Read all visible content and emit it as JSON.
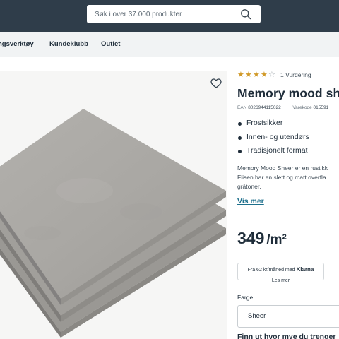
{
  "search": {
    "placeholder": "Søk i over 37.000 produkter",
    "value": ""
  },
  "nav": {
    "items": [
      {
        "label": "ngsverktøy"
      },
      {
        "label": "Kundeklubb"
      },
      {
        "label": "Outlet"
      }
    ]
  },
  "product": {
    "rating": {
      "stars": 4,
      "max": 5,
      "reviews_label": "1 Vurdering"
    },
    "title": "Memory mood she",
    "ean_label": "EAN",
    "ean": "8026944115022",
    "sku_label": "Varekode",
    "sku": "015591",
    "bullets": [
      "Frostsikker",
      "Innen- og utendørs",
      "Tradisjonelt format"
    ],
    "description_lines": [
      "Memory Mood Sheer er en rustikk",
      "Flisen har en slett og matt overfla",
      "gråtoner."
    ],
    "more_link": "Vis mer",
    "price": {
      "value": "349",
      "unit": "/m²"
    },
    "klarna": {
      "text": "Fra 62 kr/måned med",
      "logo": "Klarna",
      "link": "Les mer"
    },
    "color": {
      "label": "Farge",
      "selected": "Sheer"
    },
    "helper_heading": "Finn ut hvor mye du trenger"
  },
  "icons": {
    "search": "search-icon",
    "favorite": "heart-icon",
    "star": "star-icon"
  },
  "colors": {
    "header_bg": "#2f3d4a",
    "star": "#d19a2a",
    "link": "#1d6f8c",
    "tile": "#a8a6a2"
  }
}
